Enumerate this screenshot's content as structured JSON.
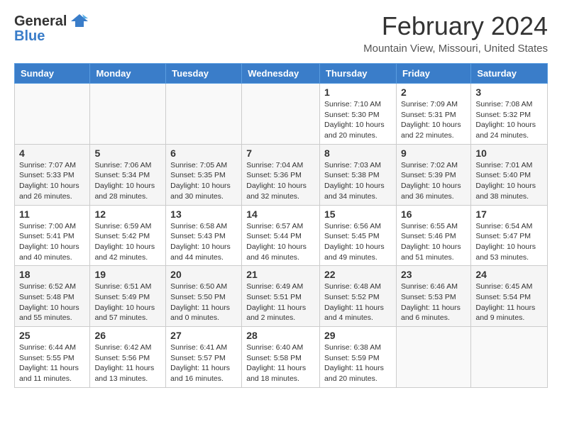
{
  "header": {
    "logo_general": "General",
    "logo_blue": "Blue",
    "month_year": "February 2024",
    "location": "Mountain View, Missouri, United States"
  },
  "weekdays": [
    "Sunday",
    "Monday",
    "Tuesday",
    "Wednesday",
    "Thursday",
    "Friday",
    "Saturday"
  ],
  "weeks": [
    [
      {
        "day": "",
        "info": ""
      },
      {
        "day": "",
        "info": ""
      },
      {
        "day": "",
        "info": ""
      },
      {
        "day": "",
        "info": ""
      },
      {
        "day": "1",
        "info": "Sunrise: 7:10 AM\nSunset: 5:30 PM\nDaylight: 10 hours\nand 20 minutes."
      },
      {
        "day": "2",
        "info": "Sunrise: 7:09 AM\nSunset: 5:31 PM\nDaylight: 10 hours\nand 22 minutes."
      },
      {
        "day": "3",
        "info": "Sunrise: 7:08 AM\nSunset: 5:32 PM\nDaylight: 10 hours\nand 24 minutes."
      }
    ],
    [
      {
        "day": "4",
        "info": "Sunrise: 7:07 AM\nSunset: 5:33 PM\nDaylight: 10 hours\nand 26 minutes."
      },
      {
        "day": "5",
        "info": "Sunrise: 7:06 AM\nSunset: 5:34 PM\nDaylight: 10 hours\nand 28 minutes."
      },
      {
        "day": "6",
        "info": "Sunrise: 7:05 AM\nSunset: 5:35 PM\nDaylight: 10 hours\nand 30 minutes."
      },
      {
        "day": "7",
        "info": "Sunrise: 7:04 AM\nSunset: 5:36 PM\nDaylight: 10 hours\nand 32 minutes."
      },
      {
        "day": "8",
        "info": "Sunrise: 7:03 AM\nSunset: 5:38 PM\nDaylight: 10 hours\nand 34 minutes."
      },
      {
        "day": "9",
        "info": "Sunrise: 7:02 AM\nSunset: 5:39 PM\nDaylight: 10 hours\nand 36 minutes."
      },
      {
        "day": "10",
        "info": "Sunrise: 7:01 AM\nSunset: 5:40 PM\nDaylight: 10 hours\nand 38 minutes."
      }
    ],
    [
      {
        "day": "11",
        "info": "Sunrise: 7:00 AM\nSunset: 5:41 PM\nDaylight: 10 hours\nand 40 minutes."
      },
      {
        "day": "12",
        "info": "Sunrise: 6:59 AM\nSunset: 5:42 PM\nDaylight: 10 hours\nand 42 minutes."
      },
      {
        "day": "13",
        "info": "Sunrise: 6:58 AM\nSunset: 5:43 PM\nDaylight: 10 hours\nand 44 minutes."
      },
      {
        "day": "14",
        "info": "Sunrise: 6:57 AM\nSunset: 5:44 PM\nDaylight: 10 hours\nand 46 minutes."
      },
      {
        "day": "15",
        "info": "Sunrise: 6:56 AM\nSunset: 5:45 PM\nDaylight: 10 hours\nand 49 minutes."
      },
      {
        "day": "16",
        "info": "Sunrise: 6:55 AM\nSunset: 5:46 PM\nDaylight: 10 hours\nand 51 minutes."
      },
      {
        "day": "17",
        "info": "Sunrise: 6:54 AM\nSunset: 5:47 PM\nDaylight: 10 hours\nand 53 minutes."
      }
    ],
    [
      {
        "day": "18",
        "info": "Sunrise: 6:52 AM\nSunset: 5:48 PM\nDaylight: 10 hours\nand 55 minutes."
      },
      {
        "day": "19",
        "info": "Sunrise: 6:51 AM\nSunset: 5:49 PM\nDaylight: 10 hours\nand 57 minutes."
      },
      {
        "day": "20",
        "info": "Sunrise: 6:50 AM\nSunset: 5:50 PM\nDaylight: 11 hours\nand 0 minutes."
      },
      {
        "day": "21",
        "info": "Sunrise: 6:49 AM\nSunset: 5:51 PM\nDaylight: 11 hours\nand 2 minutes."
      },
      {
        "day": "22",
        "info": "Sunrise: 6:48 AM\nSunset: 5:52 PM\nDaylight: 11 hours\nand 4 minutes."
      },
      {
        "day": "23",
        "info": "Sunrise: 6:46 AM\nSunset: 5:53 PM\nDaylight: 11 hours\nand 6 minutes."
      },
      {
        "day": "24",
        "info": "Sunrise: 6:45 AM\nSunset: 5:54 PM\nDaylight: 11 hours\nand 9 minutes."
      }
    ],
    [
      {
        "day": "25",
        "info": "Sunrise: 6:44 AM\nSunset: 5:55 PM\nDaylight: 11 hours\nand 11 minutes."
      },
      {
        "day": "26",
        "info": "Sunrise: 6:42 AM\nSunset: 5:56 PM\nDaylight: 11 hours\nand 13 minutes."
      },
      {
        "day": "27",
        "info": "Sunrise: 6:41 AM\nSunset: 5:57 PM\nDaylight: 11 hours\nand 16 minutes."
      },
      {
        "day": "28",
        "info": "Sunrise: 6:40 AM\nSunset: 5:58 PM\nDaylight: 11 hours\nand 18 minutes."
      },
      {
        "day": "29",
        "info": "Sunrise: 6:38 AM\nSunset: 5:59 PM\nDaylight: 11 hours\nand 20 minutes."
      },
      {
        "day": "",
        "info": ""
      },
      {
        "day": "",
        "info": ""
      }
    ]
  ]
}
